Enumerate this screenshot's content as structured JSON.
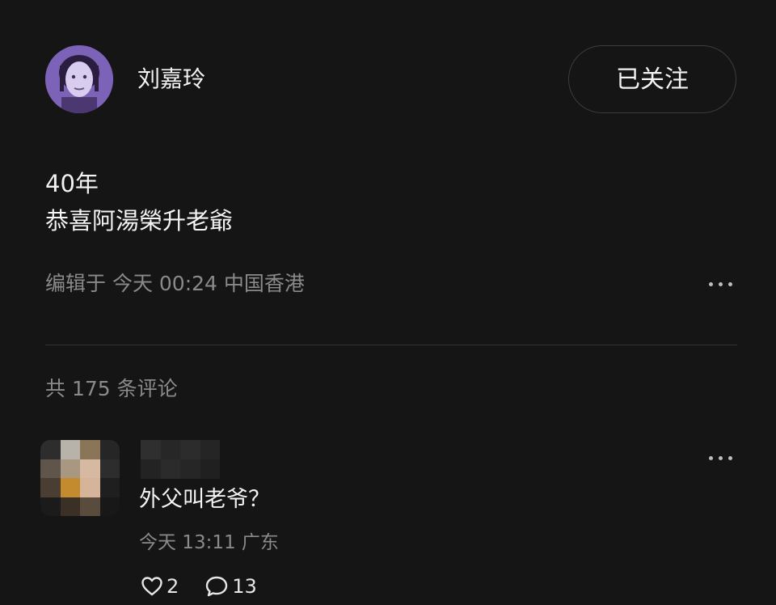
{
  "post": {
    "author": {
      "name": "刘嘉玲",
      "avatar_icon": "portrait-avatar-icon"
    },
    "follow_label": "已关注",
    "text_lines": [
      "40年",
      "恭喜阿湯榮升老爺"
    ],
    "meta": "编辑于 今天 00:24 中国香港",
    "more_icon": "more-horizontal-icon"
  },
  "comments_section": {
    "count_label": "共 175 条评论",
    "comments": [
      {
        "avatar_icon": "blurred-avatar-icon",
        "username_icon": "blurred-username-icon",
        "text": "外父叫老爷？",
        "meta": "今天 13:11 广东",
        "likes": "2",
        "replies": "13",
        "like_icon": "heart-icon",
        "reply_icon": "comment-bubble-icon",
        "more_icon": "more-horizontal-icon"
      }
    ]
  },
  "colors": {
    "background": "#151515",
    "text_primary": "#f4f4f4",
    "text_secondary": "#8a8a8a",
    "divider": "#333333"
  }
}
